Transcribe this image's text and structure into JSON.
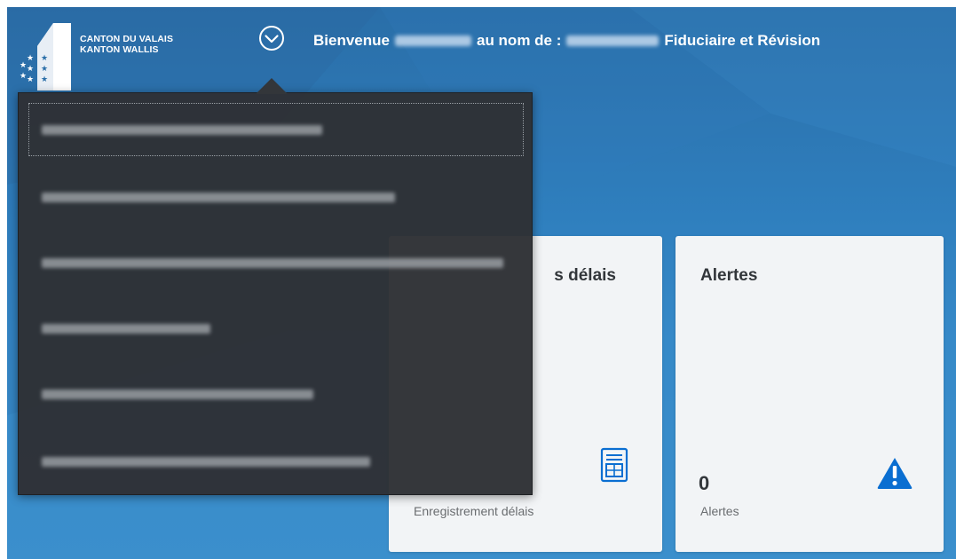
{
  "header": {
    "logo": {
      "line1": "CANTON DU VALAIS",
      "line2": "KANTON WALLIS"
    },
    "menu_toggle_icon": "chevron-down-circle-icon",
    "welcome": {
      "prefix": "Bienvenue",
      "middle": "au nom de :",
      "company": "Fiduciaire et Révision"
    }
  },
  "dropdown": {
    "items": [
      {
        "label": "",
        "focused": true
      },
      {
        "label": "",
        "focused": false
      },
      {
        "label": "",
        "focused": false
      },
      {
        "label": "",
        "focused": false
      },
      {
        "label": "",
        "focused": false
      },
      {
        "label": "",
        "focused": false
      }
    ]
  },
  "tiles": {
    "deadlines": {
      "title": "s délais",
      "footer": "Enregistrement délais",
      "icon": "form-table-icon"
    },
    "alerts": {
      "title": "Alertes",
      "count": "0",
      "footer": "Alertes",
      "icon": "warning-triangle-icon"
    }
  },
  "colors": {
    "background": "#2f7fbe",
    "dropdown": "#2e3135",
    "tile": "#f2f4f6",
    "accent": "#0a6ed1"
  }
}
